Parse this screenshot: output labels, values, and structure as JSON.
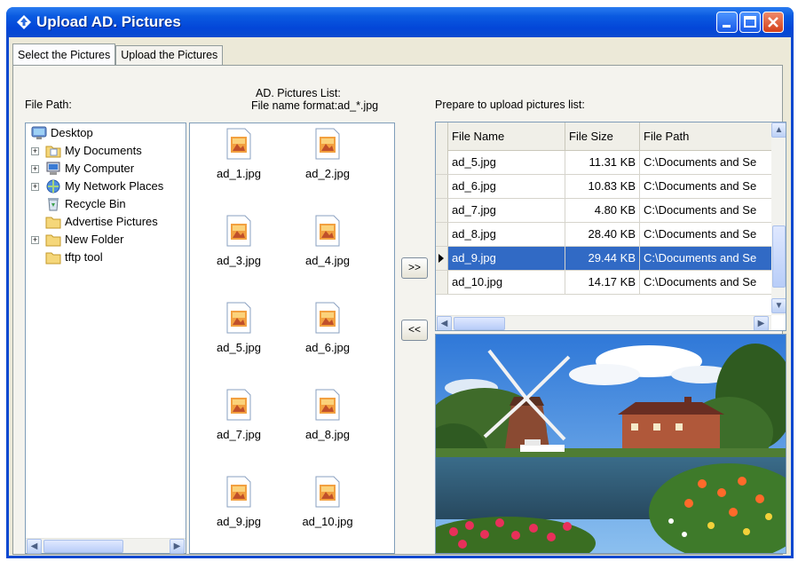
{
  "window": {
    "title": "Upload AD. Pictures",
    "title_icon": "diamond-arrow-icon"
  },
  "tabs": [
    {
      "label": "Select the Pictures",
      "active": true
    },
    {
      "label": "Upload the Pictures",
      "active": false
    }
  ],
  "labels": {
    "file_path": "File Path:",
    "pictures_list_line1": "AD. Pictures List:",
    "pictures_list_line2": "File name format:ad_*.jpg",
    "prepare_list": "Prepare to upload pictures list:"
  },
  "tree": [
    {
      "label": "Desktop",
      "icon": "desktop-icon",
      "expander": ""
    },
    {
      "label": "My Documents",
      "icon": "folder-documents-icon",
      "expander": "+"
    },
    {
      "label": "My Computer",
      "icon": "computer-icon",
      "expander": "+"
    },
    {
      "label": "My Network Places",
      "icon": "network-icon",
      "expander": "+"
    },
    {
      "label": "Recycle Bin",
      "icon": "recycle-bin-icon",
      "expander": ""
    },
    {
      "label": "Advertise Pictures",
      "icon": "folder-icon",
      "expander": ""
    },
    {
      "label": "New Folder",
      "icon": "folder-icon",
      "expander": "+"
    },
    {
      "label": "tftp tool",
      "icon": "folder-icon",
      "expander": ""
    }
  ],
  "files": [
    "ad_1.jpg",
    "ad_2.jpg",
    "ad_3.jpg",
    "ad_4.jpg",
    "ad_5.jpg",
    "ad_6.jpg",
    "ad_7.jpg",
    "ad_8.jpg",
    "ad_9.jpg",
    "ad_10.jpg"
  ],
  "buttons": {
    "add": ">>",
    "remove": "<<"
  },
  "upload_table": {
    "columns": [
      "File Name",
      "File Size",
      "File Path"
    ],
    "rows": [
      {
        "name": "ad_5.jpg",
        "size": "11.31 KB",
        "path": "C:\\Documents and Se",
        "selected": false
      },
      {
        "name": "ad_6.jpg",
        "size": "10.83 KB",
        "path": "C:\\Documents and Se",
        "selected": false
      },
      {
        "name": "ad_7.jpg",
        "size": "4.80 KB",
        "path": "C:\\Documents and Se",
        "selected": false
      },
      {
        "name": "ad_8.jpg",
        "size": "28.40 KB",
        "path": "C:\\Documents and Se",
        "selected": false
      },
      {
        "name": "ad_9.jpg",
        "size": "29.44 KB",
        "path": "C:\\Documents and Se",
        "selected": true
      },
      {
        "name": "ad_10.jpg",
        "size": "14.17 KB",
        "path": "C:\\Documents and Se",
        "selected": false
      }
    ]
  },
  "colors": {
    "titlebar": "#0a5ae0",
    "selection": "#316ac5",
    "window_bg": "#ece9d8"
  }
}
